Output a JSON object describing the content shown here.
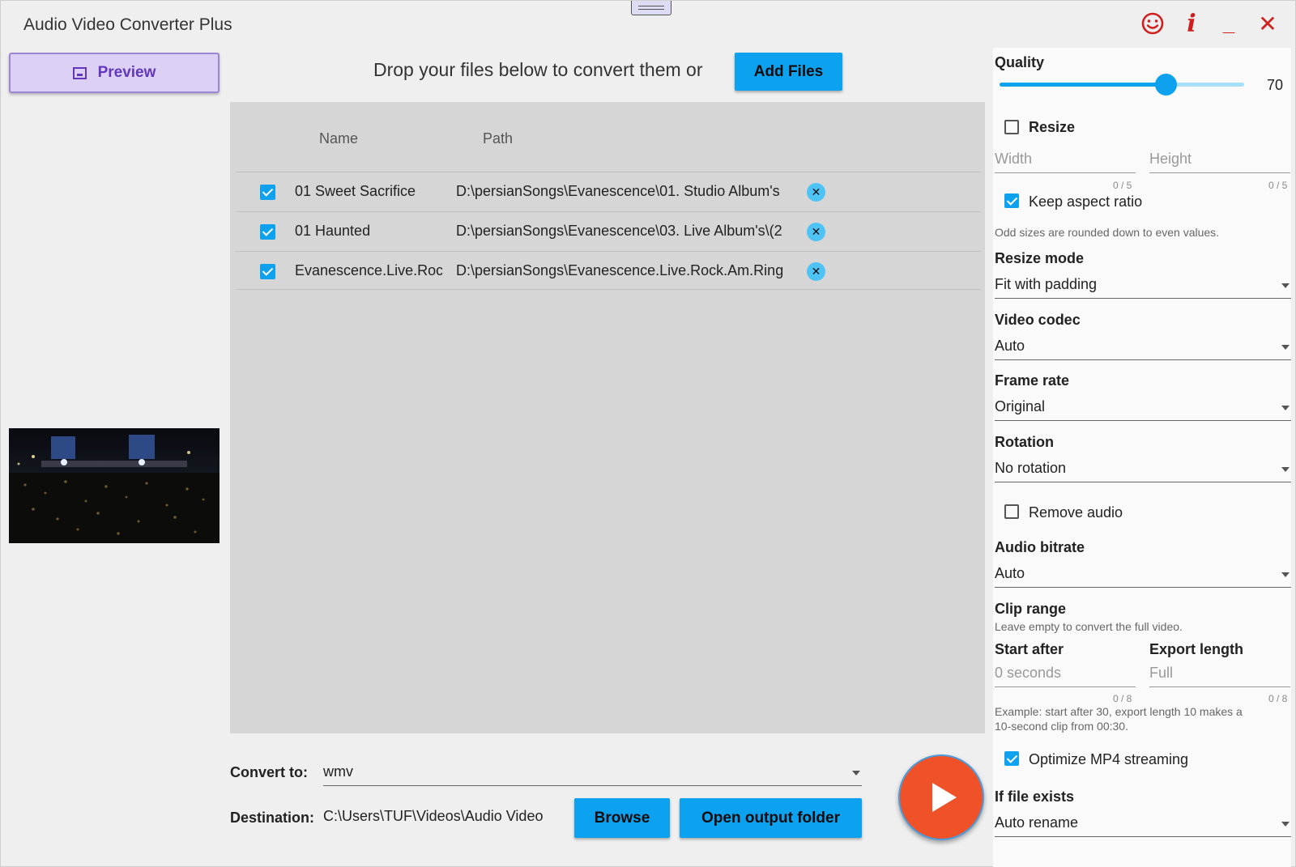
{
  "app": {
    "title": "Audio Video Converter Plus",
    "window_buttons": [
      "smiley-icon",
      "info-icon",
      "minimize-icon",
      "close-icon"
    ],
    "info_glyph": "i",
    "minimize_glyph": "_",
    "close_glyph": "✕"
  },
  "left": {
    "preview_label": "Preview"
  },
  "header": {
    "drop_text": "Drop your files below to convert them or",
    "add_files_label": "Add Files"
  },
  "files": {
    "columns": [
      "Name",
      "Path"
    ],
    "rows": [
      {
        "checked": true,
        "name": "01 Sweet Sacrifice",
        "path": "D:\\persianSongs\\Evanescence\\01. Studio Album's"
      },
      {
        "checked": true,
        "name": "01 Haunted",
        "path": "D:\\persianSongs\\Evanescence\\03. Live Album's\\(2"
      },
      {
        "checked": true,
        "name": "Evanescence.Live.Roc",
        "path": "D:\\persianSongs\\Evanescence.Live.Rock.Am.Ring"
      }
    ],
    "remove_glyph": "✕"
  },
  "output": {
    "convert_label": "Convert to:",
    "convert_value": "wmv",
    "destination_label": "Destination:",
    "destination_value": "C:\\Users\\TUF\\Videos\\Audio Video",
    "browse_label": "Browse",
    "open_folder_label": "Open output folder"
  },
  "settings": {
    "quality_label": "Quality",
    "quality_value": "70",
    "quality_fraction": 0.68,
    "resize_label": "Resize",
    "resize_checked": false,
    "width_placeholder": "Width",
    "height_placeholder": "Height",
    "width_count": "0 / 5",
    "height_count": "0 / 5",
    "keep_aspect_label": "Keep aspect ratio",
    "keep_aspect_checked": true,
    "odd_sizes_hint": "Odd sizes are rounded down to even values.",
    "resize_mode_label": "Resize mode",
    "resize_mode_value": "Fit with padding",
    "video_codec_label": "Video codec",
    "video_codec_value": "Auto",
    "frame_rate_label": "Frame rate",
    "frame_rate_value": "Original",
    "rotation_label": "Rotation",
    "rotation_value": "No rotation",
    "remove_audio_label": "Remove audio",
    "remove_audio_checked": false,
    "audio_bitrate_label": "Audio bitrate",
    "audio_bitrate_value": "Auto",
    "clip_range_label": "Clip range",
    "clip_range_hint": "Leave empty to convert the full video.",
    "start_after_label": "Start after",
    "export_length_label": "Export length",
    "start_after_placeholder": "0 seconds",
    "export_length_placeholder": "Full",
    "start_count": "0 / 8",
    "export_count": "0 / 8",
    "example_line1": "Example: start after 30, export length 10 makes a",
    "example_line2": "10-second clip from 00:30.",
    "optimize_label": "Optimize MP4 streaming",
    "optimize_checked": true,
    "if_exists_label": "If file exists",
    "if_exists_value": "Auto rename"
  },
  "colors": {
    "accent_blue": "#0da2f0",
    "play_orange": "#ef5228",
    "window_red": "#d11f1f",
    "preview_purple": "#6237b9"
  }
}
